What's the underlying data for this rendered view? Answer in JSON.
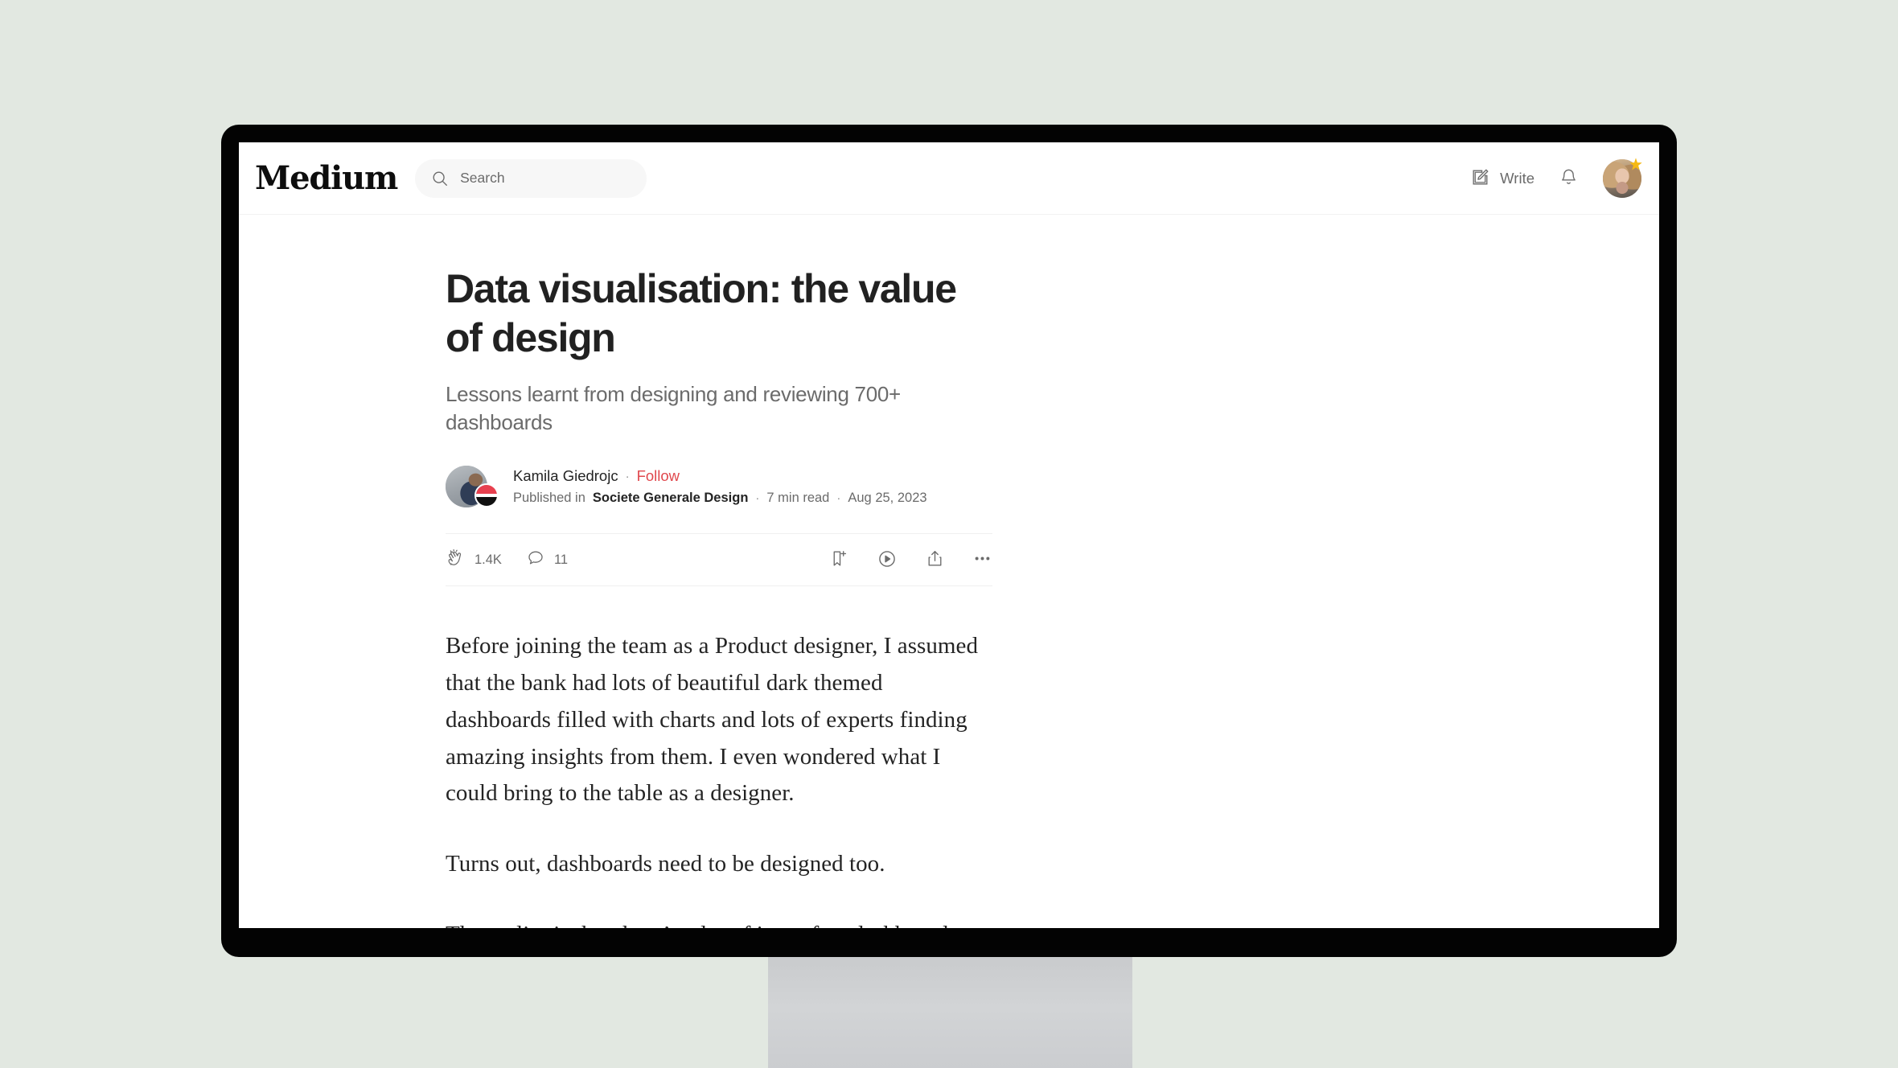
{
  "topnav": {
    "brand": "Medium",
    "search_placeholder": "Search",
    "write_label": "Write",
    "icons": {
      "search": "search-icon",
      "write": "pencil-square-icon",
      "bell": "bell-icon",
      "avatar_badge": "star-icon"
    }
  },
  "article": {
    "title": "Data visualisation: the value of design",
    "subtitle": "Lessons learnt from designing and reviewing 700+ dashboards",
    "author": "Kamila Giedrojc",
    "follow_label": "Follow",
    "published_prefix": "Published in",
    "publication": "Societe Generale Design",
    "read_time": "7 min read",
    "date": "Aug 25, 2023",
    "separator": "·",
    "engagement": {
      "claps": "1.4K",
      "comments": "11",
      "clap_icon": "clap-icon",
      "comment_icon": "comment-icon",
      "bookmark_icon": "bookmark-plus-icon",
      "listen_icon": "play-circle-icon",
      "share_icon": "share-icon",
      "more_icon": "ellipsis-icon"
    },
    "paragraphs": [
      "Before joining the team as a Product designer, I assumed that the bank had lots of beautiful dark themed dashboards filled with charts and lots of experts finding amazing insights from them. I even wondered what I could bring to the table as a designer.",
      "Turns out, dashboards need to be designed too.",
      "The reality is that there’s a lot of imperfect dashboards with data tables everywhere and a lot of acronyms users don’t understand. Three years and 700+ dashboards later, this is how I add value as a designer."
    ]
  },
  "colors": {
    "background": "#e2e8e1",
    "bezel": "#030303",
    "follow_red": "#e0484d",
    "text_primary": "#242424",
    "text_muted": "#6b6b6b",
    "star_badge": "#f5b912"
  }
}
